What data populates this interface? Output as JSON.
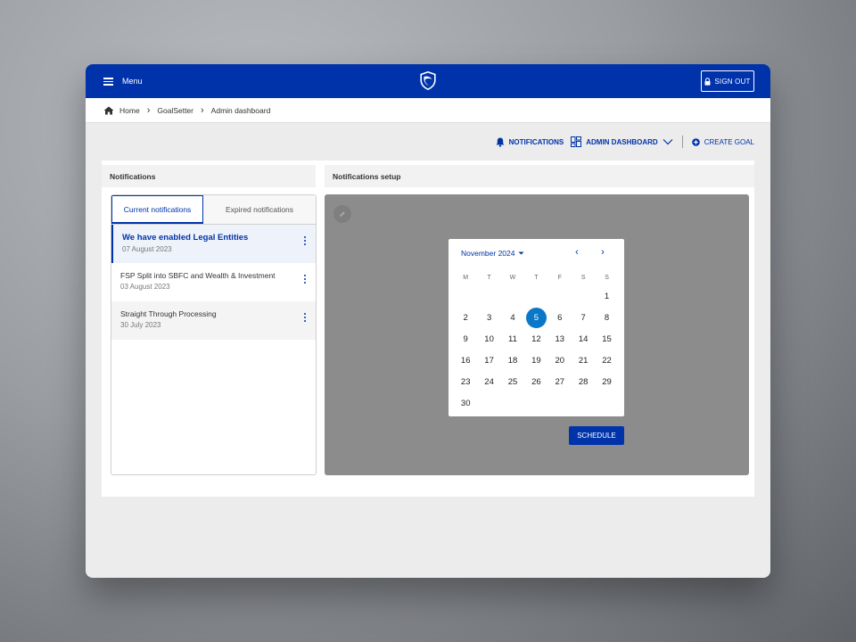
{
  "topbar": {
    "menu_label": "Menu",
    "signout_label": "SIGN OUT"
  },
  "breadcrumb": [
    "Home",
    "GoalSetter",
    "Admin dashboard"
  ],
  "actions": {
    "notifications": "NOTIFICATIONS",
    "admin_dashboard": "ADMIN DASHBOARD",
    "create_goal": "CREATE GOAL"
  },
  "notifications_panel": {
    "title": "Notifications",
    "tabs": [
      "Current notifications",
      "Expired notifications"
    ],
    "items": [
      {
        "title": "We have enabled Legal Entities",
        "date": "07 August 2023"
      },
      {
        "title": "FSP Split into SBFC and Wealth & Investment",
        "date": "03 August 2023"
      },
      {
        "title": "Straight Through Processing",
        "date": "30 July 2023"
      }
    ]
  },
  "setup_panel": {
    "title": "Notifications setup",
    "calendar": {
      "month_label": "November 2024",
      "weekdays": [
        "M",
        "T",
        "W",
        "T",
        "F",
        "S",
        "S"
      ],
      "selected_day": 5,
      "rows": [
        [
          "",
          "",
          "",
          "",
          "",
          "",
          "1"
        ],
        [
          "2",
          "3",
          "4",
          "5",
          "6",
          "7",
          "8"
        ],
        [
          "9",
          "10",
          "11",
          "12",
          "13",
          "14",
          "15"
        ],
        [
          "16",
          "17",
          "18",
          "19",
          "20",
          "21",
          "22"
        ],
        [
          "23",
          "24",
          "25",
          "26",
          "27",
          "28",
          "29"
        ],
        [
          "30",
          "",
          "",
          "",
          "",
          "",
          ""
        ]
      ]
    },
    "schedule_label": "SCHEDULE"
  },
  "colors": {
    "brand": "#0033aa",
    "selected_day": "#0a78c8",
    "overlay": "#8c8c8c"
  }
}
